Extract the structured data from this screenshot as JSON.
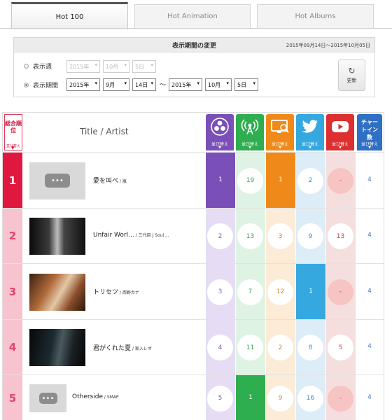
{
  "tabs": [
    {
      "label": "Hot 100",
      "active": true
    },
    {
      "label": "Hot Animation",
      "active": false
    },
    {
      "label": "Hot Albums",
      "active": false
    }
  ],
  "period": {
    "title": "表示期間の変更",
    "range": "2015年09月14日～2015年10月05日",
    "week_label": "表示週",
    "range_label": "表示期間",
    "week_selects": [
      "2015年",
      "10月",
      "5日"
    ],
    "from_selects": [
      "2015年",
      "9月",
      "14日"
    ],
    "tilde": "～",
    "to_selects": [
      "2015年",
      "10月",
      "5日"
    ],
    "update_label": "更新"
  },
  "table": {
    "rank_header": "総合順位",
    "sort_label": "並び替え",
    "title_header": "Title / Artist",
    "chart_in_header": "チャートイン数",
    "columns": [
      {
        "icon": "sales-icon",
        "color": "#7a4fb7",
        "light": "#e6dcf4"
      },
      {
        "icon": "radio-icon",
        "color": "#2eae4f",
        "light": "#dff3e4"
      },
      {
        "icon": "lookup-icon",
        "color": "#ef8a1a",
        "light": "#fcebd6"
      },
      {
        "icon": "twitter-icon",
        "color": "#35a8e0",
        "light": "#dcedf8"
      },
      {
        "icon": "youtube-icon",
        "color": "#dd2f2f",
        "light": "#f5dede"
      }
    ],
    "rows": [
      {
        "rank": "1",
        "title": "愛を叫べ",
        "artist": "嵐",
        "thumb": "placeholder",
        "values": [
          "1",
          "19",
          "1",
          "2",
          "-"
        ],
        "chart_in": "4"
      },
      {
        "rank": "2",
        "title": "Unfair Worl...",
        "artist": "三代目 J Soul ...",
        "thumb": "video",
        "values": [
          "2",
          "13",
          "3",
          "9",
          "13"
        ],
        "chart_in": "4"
      },
      {
        "rank": "3",
        "title": "トリセツ",
        "artist": "西野カナ",
        "thumb": "video",
        "values": [
          "3",
          "7",
          "12",
          "1",
          "-"
        ],
        "chart_in": "4"
      },
      {
        "rank": "4",
        "title": "君がくれた夏",
        "artist": "家入レオ",
        "thumb": "video",
        "values": [
          "4",
          "11",
          "2",
          "8",
          "5"
        ],
        "chart_in": "4"
      },
      {
        "rank": "5",
        "title": "Otherside",
        "artist": "SMAP",
        "thumb": "placeholder",
        "values": [
          "5",
          "1",
          "9",
          "16",
          "-"
        ],
        "chart_in": "4"
      }
    ]
  }
}
